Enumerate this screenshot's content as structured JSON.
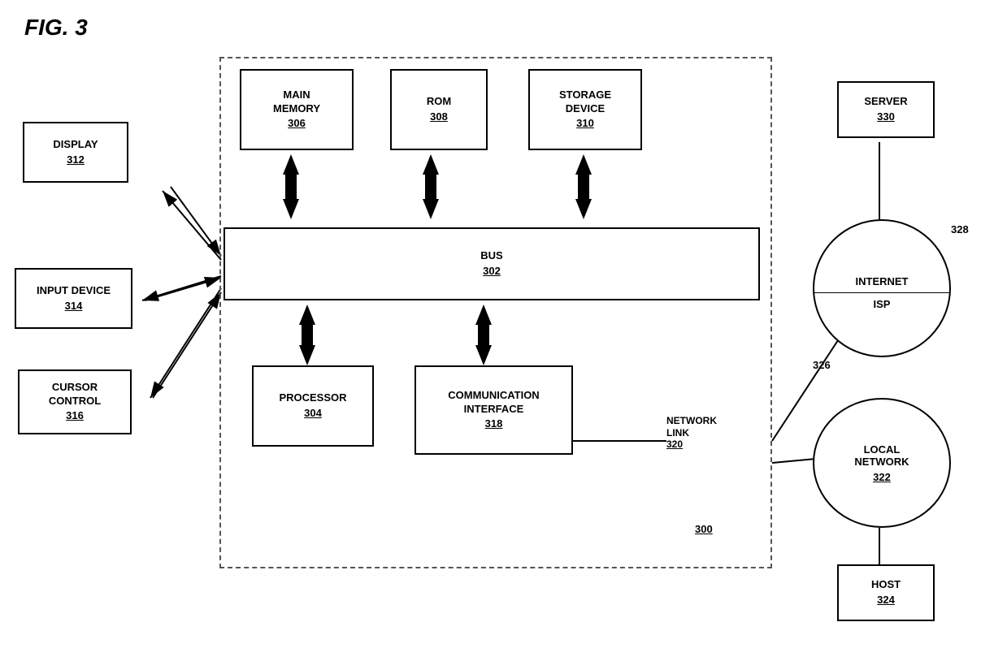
{
  "title": "FIG. 3",
  "components": {
    "main_memory": {
      "label": "MAIN\nMEMORY",
      "ref": "306"
    },
    "rom": {
      "label": "ROM",
      "ref": "308"
    },
    "storage_device": {
      "label": "STORAGE\nDEVICE",
      "ref": "310"
    },
    "bus": {
      "label": "BUS",
      "ref": "302"
    },
    "processor": {
      "label": "PROCESSOR",
      "ref": "304"
    },
    "communication_interface": {
      "label": "COMMUNICATION\nINTERFACE",
      "ref": "318"
    },
    "display": {
      "label": "DISPLAY",
      "ref": "312"
    },
    "input_device": {
      "label": "INPUT DEVICE",
      "ref": "314"
    },
    "cursor_control": {
      "label": "CURSOR\nCONTROL",
      "ref": "316"
    },
    "server": {
      "label": "SERVER",
      "ref": "330"
    },
    "internet": {
      "label": "INTERNET\nISP",
      "ref": "328"
    },
    "local_network": {
      "label": "LOCAL\nNETWORK",
      "ref": "322"
    },
    "host": {
      "label": "HOST",
      "ref": "324"
    },
    "system": {
      "ref": "300"
    },
    "network_link": {
      "label": "NETWORK\nLINK",
      "ref": "320"
    },
    "isp_ref": {
      "ref": "326"
    }
  }
}
